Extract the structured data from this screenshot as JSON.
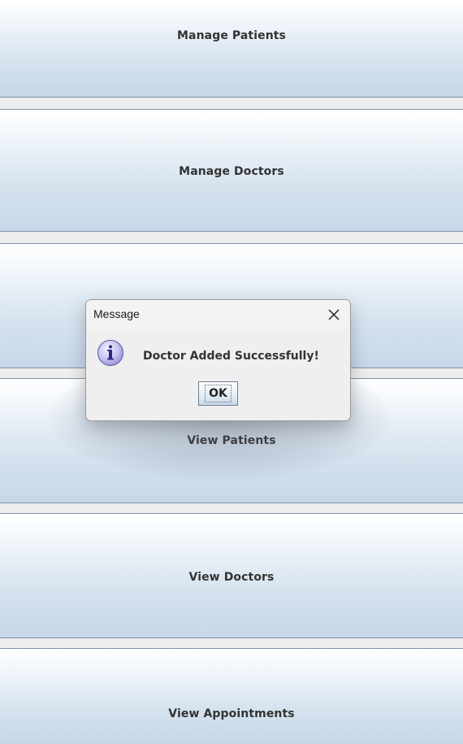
{
  "menu": {
    "buttons": [
      {
        "label": "Manage Patients"
      },
      {
        "label": "Manage Doctors"
      },
      {
        "label": ""
      },
      {
        "label": "View Patients"
      },
      {
        "label": "View Doctors"
      },
      {
        "label": "View Appointments"
      }
    ]
  },
  "dialog": {
    "title": "Message",
    "message": "Doctor Added Successfully!",
    "ok_label": "OK",
    "icon": "info-icon",
    "close_icon": "close-icon"
  },
  "colors": {
    "button_top": "#ffffff",
    "button_bottom": "#c6d7e7",
    "button_border": "#7f93a8",
    "background": "#eeeeee",
    "dialog_background": "#efefef",
    "icon_fill": "#c9c6f2"
  }
}
